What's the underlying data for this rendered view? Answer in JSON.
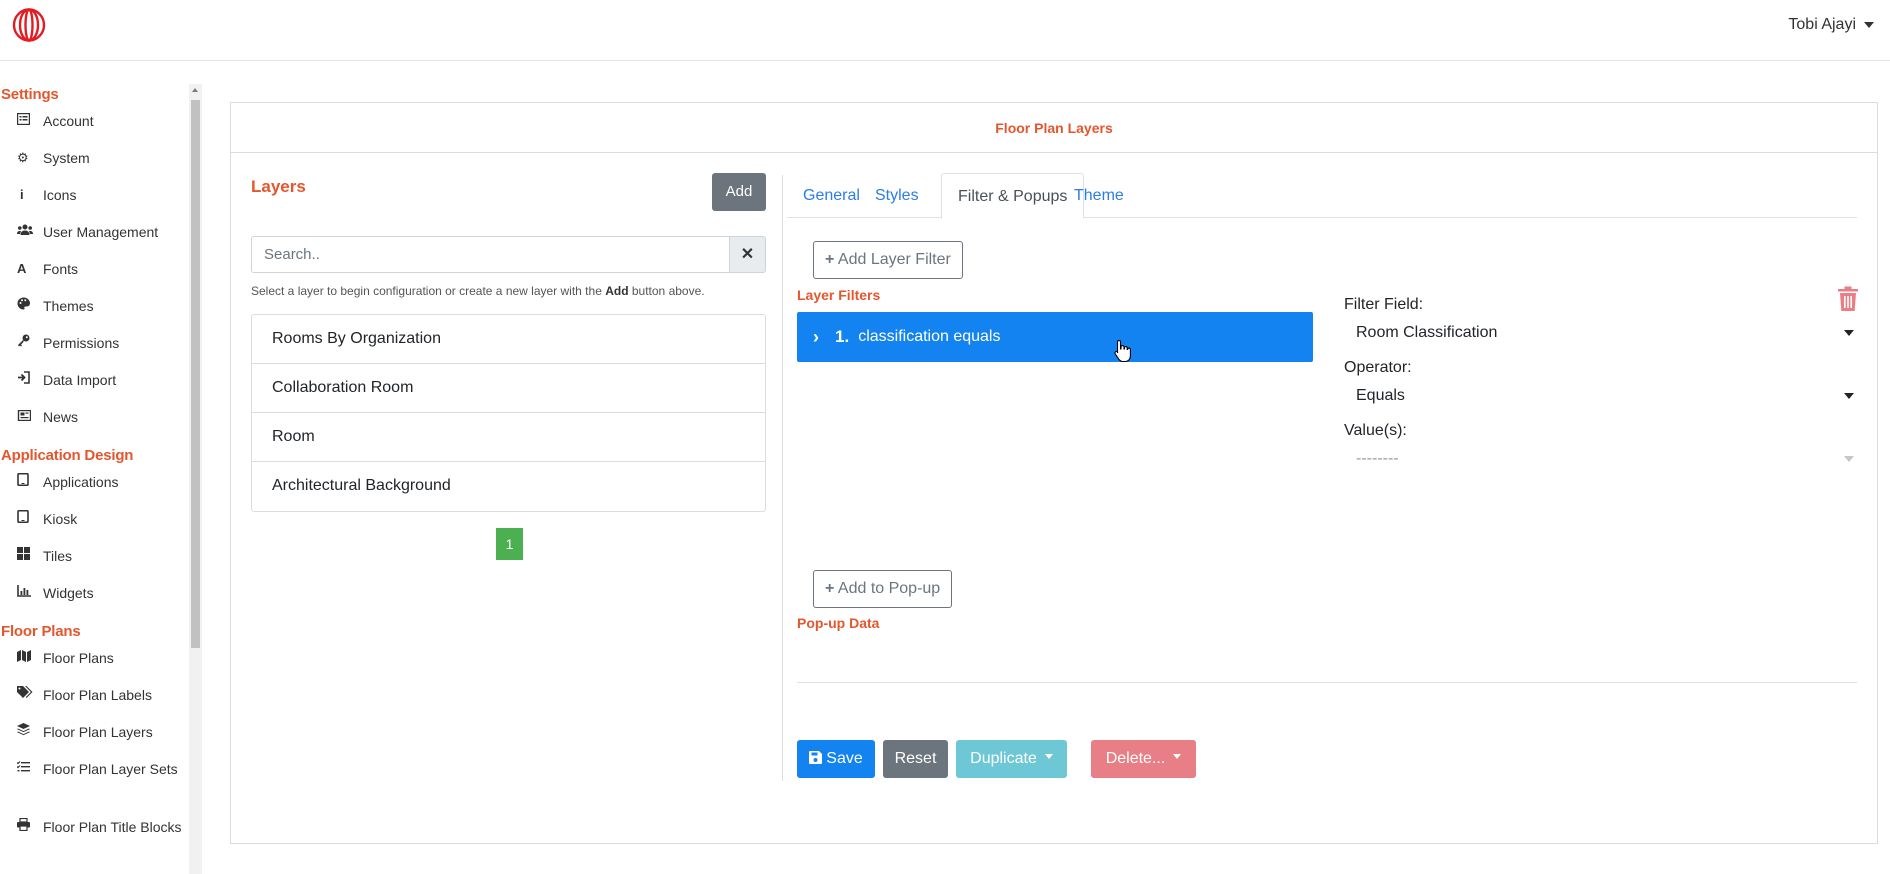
{
  "header": {
    "user_name": "Tobi Ajayi"
  },
  "sidebar": {
    "sections": [
      {
        "title": "Settings",
        "items": [
          {
            "label": "Account",
            "icon": "list-alt-icon"
          },
          {
            "label": "System",
            "icon": "gear-icon"
          },
          {
            "label": "Icons",
            "icon": "info-icon"
          },
          {
            "label": "User Management",
            "icon": "users-icon"
          },
          {
            "label": "Fonts",
            "icon": "font-icon"
          },
          {
            "label": "Themes",
            "icon": "palette-icon"
          },
          {
            "label": "Permissions",
            "icon": "key-icon"
          },
          {
            "label": "Data Import",
            "icon": "sign-in-icon"
          },
          {
            "label": "News",
            "icon": "newspaper-icon"
          }
        ]
      },
      {
        "title": "Application Design",
        "items": [
          {
            "label": "Applications",
            "icon": "tablet-icon"
          },
          {
            "label": "Kiosk",
            "icon": "tablet-icon"
          },
          {
            "label": "Tiles",
            "icon": "th-large-icon"
          },
          {
            "label": "Widgets",
            "icon": "chart-line-icon"
          }
        ]
      },
      {
        "title": "Floor Plans",
        "items": [
          {
            "label": "Floor Plans",
            "icon": "map-icon"
          },
          {
            "label": "Floor Plan Labels",
            "icon": "tags-icon"
          },
          {
            "label": "Floor Plan Layers",
            "icon": "layer-group-icon"
          },
          {
            "label": "Floor Plan Layer Sets",
            "icon": "tasks-icon"
          },
          {
            "label": "Floor Plan Title Blocks",
            "icon": "print-icon"
          }
        ]
      }
    ]
  },
  "card": {
    "title": "Floor Plan Layers"
  },
  "layers": {
    "title": "Layers",
    "add_label": "Add",
    "search_placeholder": "Search..",
    "clear_symbol": "✕",
    "hint_before": "Select a layer to begin configuration or create a new layer with the ",
    "hint_bold": "Add",
    "hint_after": " button above.",
    "items": [
      "Rooms By Organization",
      "Collaboration Room",
      "Room",
      "Architectural Background"
    ],
    "current_page": "1"
  },
  "tabs": [
    "General",
    "Styles",
    "Filter & Popups",
    "Theme"
  ],
  "active_tab": "Filter & Popups",
  "filters": {
    "add_filter_label": "Add Layer Filter",
    "section_title": "Layer Filters",
    "selected": {
      "number": "1.",
      "text": "classification equals"
    },
    "filter_field_label": "Filter Field:",
    "filter_field_value": "Room Classification",
    "operator_label": "Operator:",
    "operator_value": "Equals",
    "values_label": "Value(s):",
    "values_placeholder": "--------"
  },
  "popup": {
    "add_label": "Add to Pop-up",
    "section_title": "Pop-up Data"
  },
  "actions": {
    "save": "Save",
    "reset": "Reset",
    "duplicate": "Duplicate",
    "delete": "Delete..."
  },
  "colors": {
    "accent": "#e4572e",
    "primary": "#1283f0",
    "secondary": "#6c757d",
    "info": "#6ec7d4",
    "danger": "#e97f86",
    "pagination": "#4caf50"
  }
}
